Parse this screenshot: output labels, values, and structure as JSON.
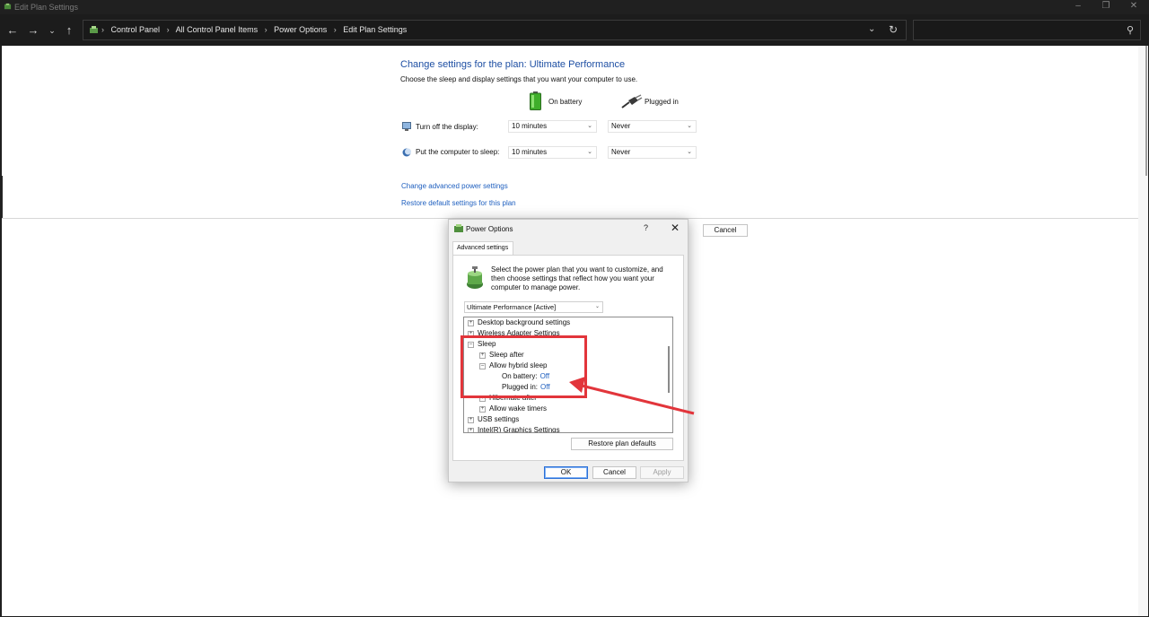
{
  "window": {
    "title": "Edit Plan Settings"
  },
  "nav": {
    "breadcrumb": [
      "Control Panel",
      "All Control Panel Items",
      "Power Options",
      "Edit Plan Settings"
    ],
    "search_placeholder": ""
  },
  "plan": {
    "title": "Change settings for the plan: Ultimate Performance",
    "description": "Choose the sleep and display settings that you want your computer to use.",
    "col_battery": "On battery",
    "col_plugged": "Plugged in",
    "display_label": "Turn off the display:",
    "display_battery": "10 minutes",
    "display_plugged": "Never",
    "sleep_label": "Put the computer to sleep:",
    "sleep_battery": "10 minutes",
    "sleep_plugged": "Never",
    "link_advanced": "Change advanced power settings",
    "link_restore": "Restore default settings for this plan",
    "cancel_label": "Cancel"
  },
  "dialog": {
    "title": "Power Options",
    "help": "?",
    "tab": "Advanced settings",
    "description": "Select the power plan that you want to customize, and then choose settings that reflect how you want your computer to manage power.",
    "plan_select": "Ultimate Performance [Active]",
    "tree": {
      "desktop_bg": "Desktop background settings",
      "wireless": "Wireless Adapter Settings",
      "sleep": "Sleep",
      "sleep_after": "Sleep after",
      "hybrid": "Allow hybrid sleep",
      "on_battery_label": "On battery:",
      "on_battery_value": "Off",
      "plugged_label": "Plugged in:",
      "plugged_value": "Off",
      "hibernate": "Hibernate after",
      "wake": "Allow wake timers",
      "usb": "USB settings",
      "graphics": "Intel(R) Graphics Settings"
    },
    "restore_label": "Restore plan defaults",
    "ok_label": "OK",
    "cancel_label": "Cancel",
    "apply_label": "Apply"
  },
  "colors": {
    "accent": "#1e4fa3",
    "link": "#1e5fbf",
    "annotation": "#e2353b"
  }
}
